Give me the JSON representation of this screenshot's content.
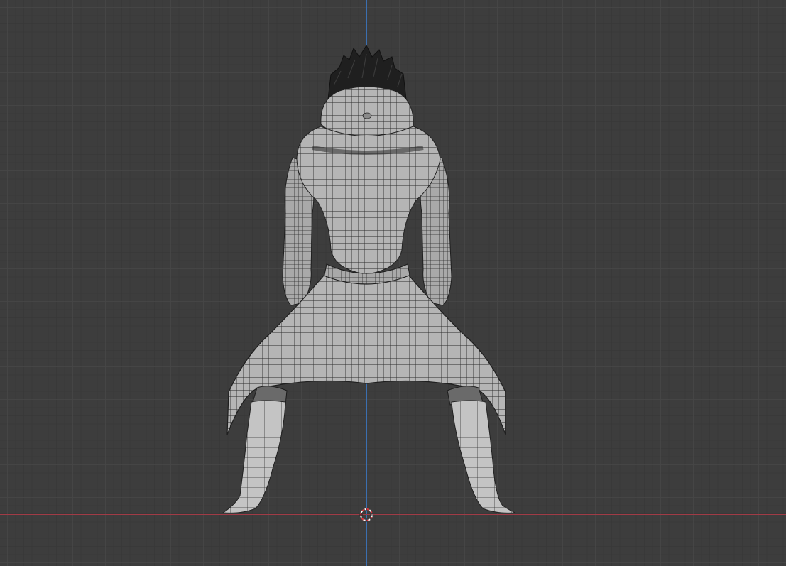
{
  "viewport": {
    "view": "back-orthographic",
    "grid": true,
    "colors": {
      "background": "#3d3d3d",
      "grid_major": "#464646",
      "axis_x": "#a13b46",
      "axis_z": "#3b6fb0",
      "mesh_fill": "#b8b8b8",
      "mesh_wire": "#2a2a2a",
      "hair": "#1e1e1e"
    }
  },
  "cursor": {
    "icon": "3d-cursor-icon"
  },
  "model": {
    "icon": "character-mesh-icon"
  }
}
